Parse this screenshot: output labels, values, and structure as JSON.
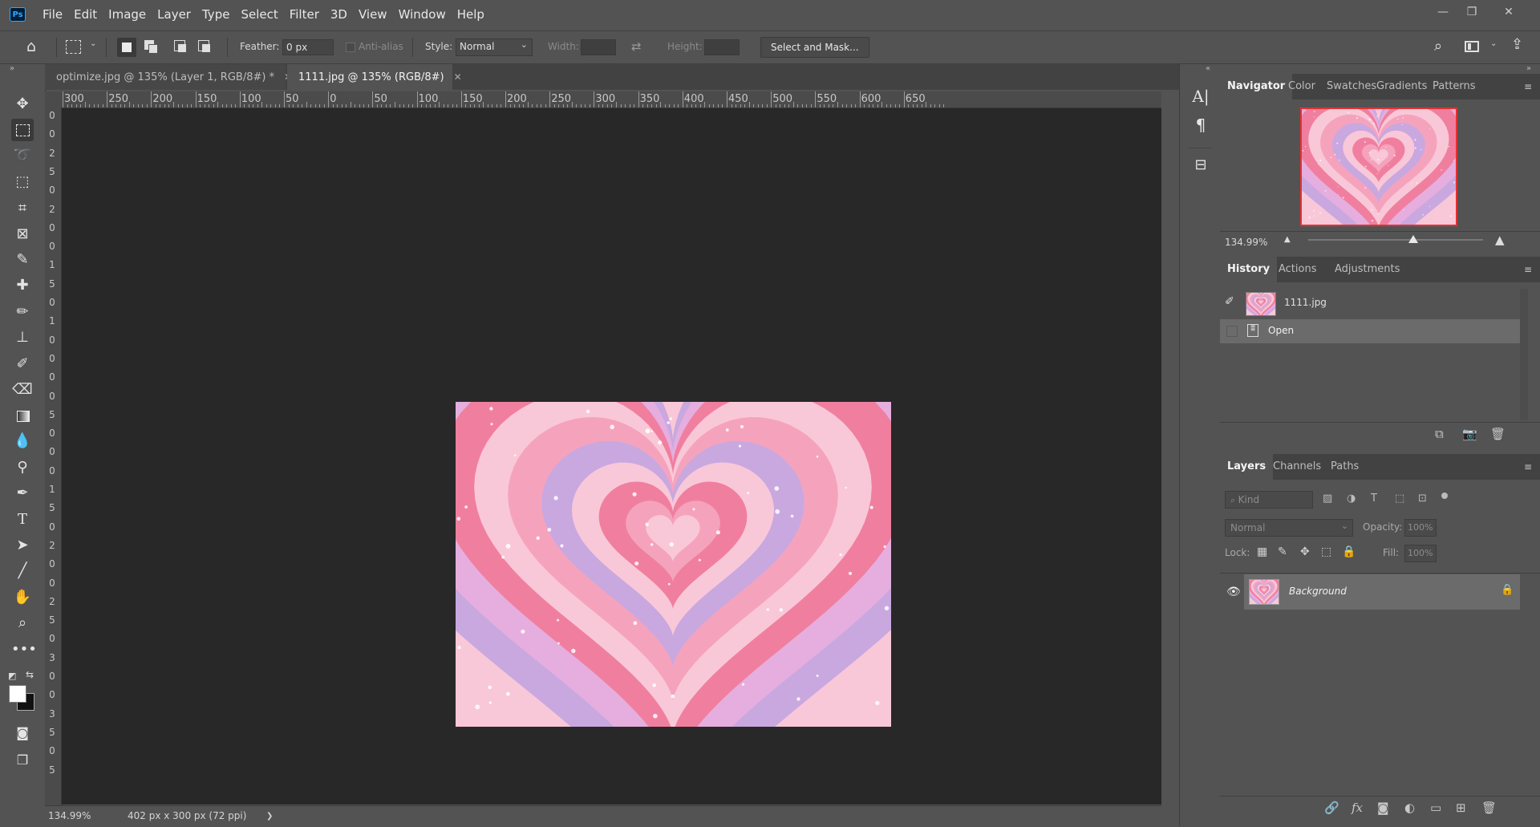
{
  "app": {
    "logo_text": "Ps"
  },
  "menu": [
    "File",
    "Edit",
    "Image",
    "Layer",
    "Type",
    "Select",
    "Filter",
    "3D",
    "View",
    "Window",
    "Help"
  ],
  "window_controls": {
    "minimize": "—",
    "restore": "❐",
    "close": "✕"
  },
  "options_bar": {
    "feather_label": "Feather:",
    "feather_value": "0 px",
    "anti_alias_label": "Anti-alias",
    "style_label": "Style:",
    "style_value": "Normal",
    "width_label": "Width:",
    "height_label": "Height:",
    "select_and_mask_label": "Select and Mask..."
  },
  "document_tabs": [
    {
      "label": "optimize.jpg @ 135% (Layer 1, RGB/8#) *",
      "active": false
    },
    {
      "label": "1111.jpg @ 135% (RGB/8#)",
      "active": true
    }
  ],
  "ruler_h_labels": [
    "300",
    "250",
    "200",
    "150",
    "100",
    "50",
    "0",
    "50",
    "100",
    "150",
    "200",
    "250",
    "300",
    "350",
    "400",
    "450",
    "500",
    "550",
    "600",
    "650"
  ],
  "ruler_v_labels": [
    "0",
    "0",
    "2",
    "5",
    "0",
    "2",
    "0",
    "0",
    "1",
    "5",
    "0",
    "1",
    "0",
    "0",
    "0",
    "0",
    "5",
    "0",
    "0",
    "0",
    "1",
    "5",
    "0",
    "2",
    "0",
    "0",
    "2",
    "5",
    "0",
    "3",
    "0",
    "0",
    "3",
    "5",
    "0",
    "5"
  ],
  "status_bar": {
    "zoom": "134.99%",
    "doc_size": "402 px x 300 px (72 ppi)",
    "arrow": "❯"
  },
  "navigator_panel": {
    "tabs": [
      "Navigator",
      "Color",
      "Swatches",
      "Gradients",
      "Patterns"
    ],
    "zoom_value": "134.99%",
    "zoom_level": 0.6
  },
  "history_panel": {
    "tabs": [
      "History",
      "Actions",
      "Adjustments"
    ],
    "snapshot_label": "1111.jpg",
    "steps": [
      "Open"
    ]
  },
  "layers_panel": {
    "tabs": [
      "Layers",
      "Channels",
      "Paths"
    ],
    "kind_placeholder": "Kind",
    "blend_mode": "Normal",
    "opacity_label": "Opacity:",
    "opacity_value": "100%",
    "lock_label": "Lock:",
    "fill_label": "Fill:",
    "fill_value": "100%",
    "layers": [
      {
        "name": "Background",
        "visible": true,
        "locked": true
      }
    ]
  },
  "colors": {
    "pink_dark": "#f07f9f",
    "pink_mid": "#f5a3bd",
    "pink_light": "#f9c8d8",
    "lavender": "#c9a8e0",
    "lilac": "#e5aede",
    "canvas_bg": "#282828"
  }
}
